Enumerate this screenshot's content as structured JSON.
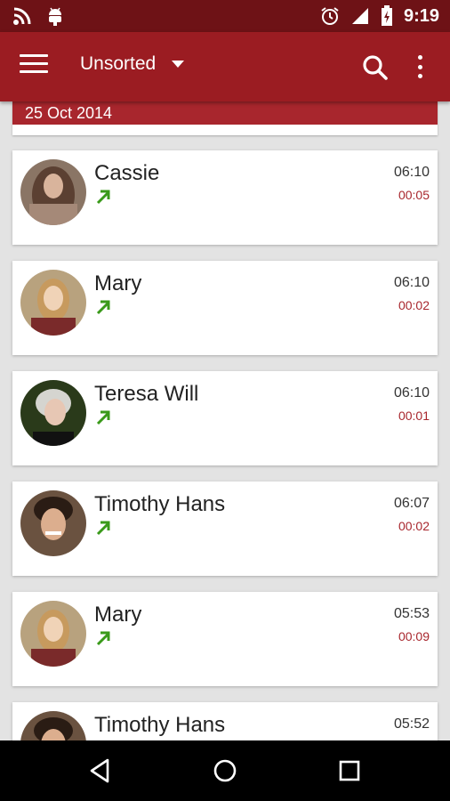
{
  "status_bar": {
    "time": "9:19",
    "icons": [
      "rss-icon",
      "android-icon",
      "alarm-icon",
      "signal-icon",
      "battery-charging-icon"
    ]
  },
  "app_bar": {
    "title": "Unsorted",
    "menu_icon": "hamburger-menu-icon",
    "search_icon": "search-icon",
    "overflow_icon": "more-vertical-icon",
    "accent_color": "#9b1c22"
  },
  "list": {
    "date_header": "25 Oct 2014",
    "calls": [
      {
        "name": "Cassie",
        "time": "06:10",
        "duration": "00:05",
        "direction": "outgoing"
      },
      {
        "name": "Mary",
        "time": "06:10",
        "duration": "00:02",
        "direction": "outgoing"
      },
      {
        "name": "Teresa Will",
        "time": "06:10",
        "duration": "00:01",
        "direction": "outgoing"
      },
      {
        "name": "Timothy Hans",
        "time": "06:07",
        "duration": "00:02",
        "direction": "outgoing"
      },
      {
        "name": "Mary",
        "time": "05:53",
        "duration": "00:09",
        "direction": "outgoing"
      },
      {
        "name": "Timothy Hans",
        "time": "05:52",
        "duration": "",
        "direction": "outgoing"
      }
    ]
  },
  "nav_bar": {
    "back_icon": "back-triangle-icon",
    "home_icon": "home-circle-icon",
    "recents_icon": "recents-square-icon"
  },
  "colors": {
    "status_bar": "#6e1216",
    "app_bar": "#9b1c22",
    "date_header": "#a8262d",
    "duration_text": "#a8262d",
    "outgoing_arrow": "#3a9a1a"
  }
}
